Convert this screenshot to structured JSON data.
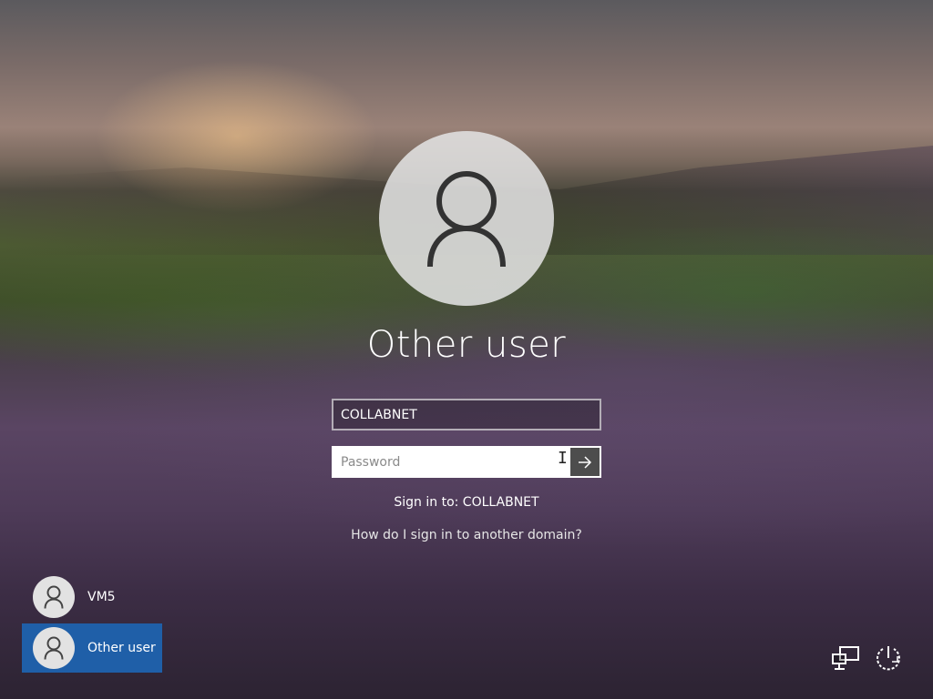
{
  "login": {
    "user_name": "Other user",
    "username_value": "COLLABNET",
    "password_placeholder": "Password",
    "sign_in_to": "Sign in to: COLLABNET",
    "domain_help_link": "How do I sign in to another domain?"
  },
  "user_tiles": [
    {
      "label": "VM5",
      "selected": false
    },
    {
      "label": "Other user",
      "selected": true
    }
  ],
  "icons": {
    "avatar": "user-silhouette-icon",
    "submit": "arrow-right-icon",
    "network": "network-icon",
    "power": "power-icon"
  },
  "colors": {
    "selected_tile": "#1f5fa8",
    "submit_button": "#4d4d4d"
  }
}
